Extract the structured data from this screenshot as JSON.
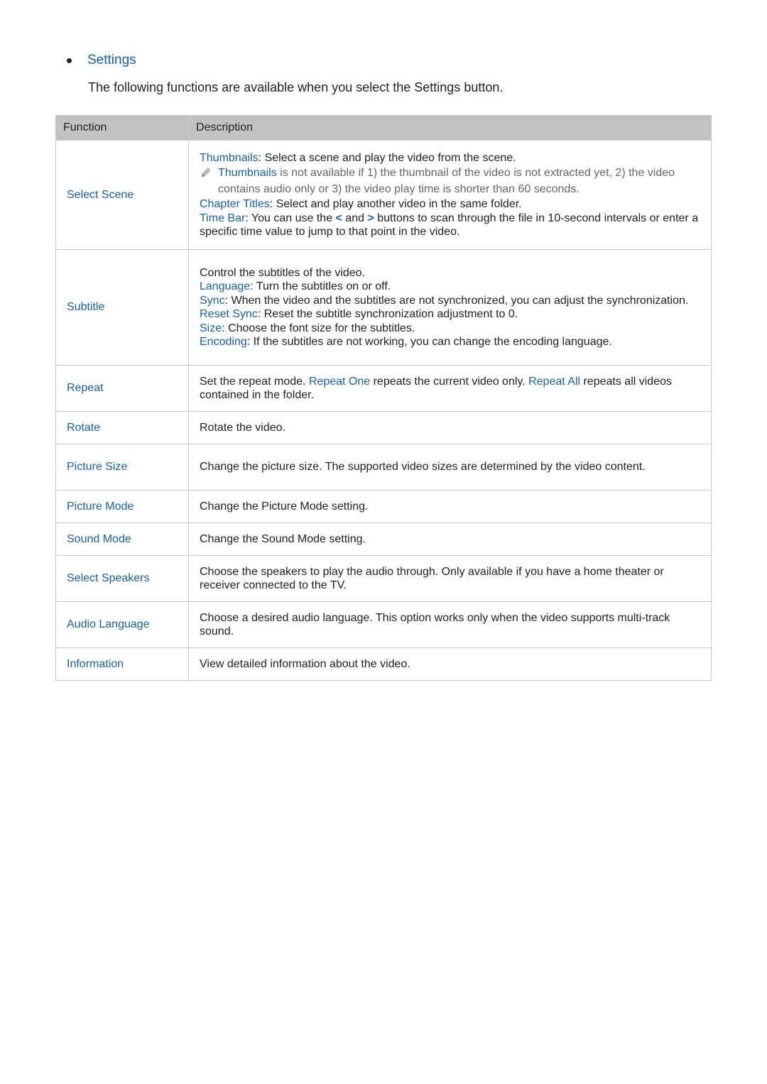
{
  "section": {
    "title": "Settings",
    "intro": "The following functions are available when you select the Settings button."
  },
  "table": {
    "headers": [
      "Function",
      "Description"
    ],
    "rows": [
      {
        "function": "Select Scene",
        "lines": [
          {
            "term": "Thumbnails",
            "text": ": Select a scene and play the video from the scene."
          },
          {
            "note_icon": "pencil-icon",
            "note_term": "Thumbnails",
            "note_text": " is not available if 1) the thumbnail of the video is not extracted yet, 2) the video contains audio only or 3) the video play time is shorter than 60 seconds."
          },
          {
            "term": "Chapter Titles",
            "text": ": Select and play another video in the same folder."
          },
          {
            "term": "Time Bar",
            "text_a": ": You can use the ",
            "icon_left": "<",
            "text_b": " and ",
            "icon_right": ">",
            "text_c": " buttons to scan through the file in 10-second intervals or enter a specific time value to jump to that point in the video."
          }
        ]
      },
      {
        "function": "Subtitle",
        "lines": [
          {
            "text": "Control the subtitles of the video."
          },
          {
            "term": "Language",
            "text": ": Turn the subtitles on or off."
          },
          {
            "term": "Sync",
            "text": ": When the video and the subtitles are not synchronized, you can adjust the synchronization."
          },
          {
            "term": "Reset Sync",
            "text": ": Reset the subtitle synchronization adjustment to 0."
          },
          {
            "term": "Size",
            "text": ": Choose the font size for the subtitles."
          },
          {
            "term": "Encoding",
            "text": ": If the subtitles are not working, you can change the encoding language."
          }
        ]
      },
      {
        "function": "Repeat",
        "parts": {
          "a": "Set the repeat mode. ",
          "term1": "Repeat One",
          "b": " repeats the current video only. ",
          "term2": "Repeat All",
          "c": " repeats all videos contained in the folder."
        }
      },
      {
        "function": "Rotate",
        "text": "Rotate the video."
      },
      {
        "function": "Picture Size",
        "text": "Change the picture size. The supported video sizes are determined by the video content."
      },
      {
        "function": "Picture Mode",
        "text": "Change the Picture Mode setting."
      },
      {
        "function": "Sound Mode",
        "text": "Change the Sound Mode setting."
      },
      {
        "function": "Select Speakers",
        "text": "Choose the speakers to play the audio through. Only available if you have a home theater or receiver connected to the TV."
      },
      {
        "function": "Audio Language",
        "text": "Choose a desired audio language. This option works only when the video supports multi-track sound."
      },
      {
        "function": "Information",
        "text": "View detailed information about the video."
      }
    ]
  },
  "colors": {
    "accent": "#1a5fa8",
    "header_bg": "#c2c2c2",
    "border": "#c8c8c8",
    "note_text": "#666666"
  }
}
